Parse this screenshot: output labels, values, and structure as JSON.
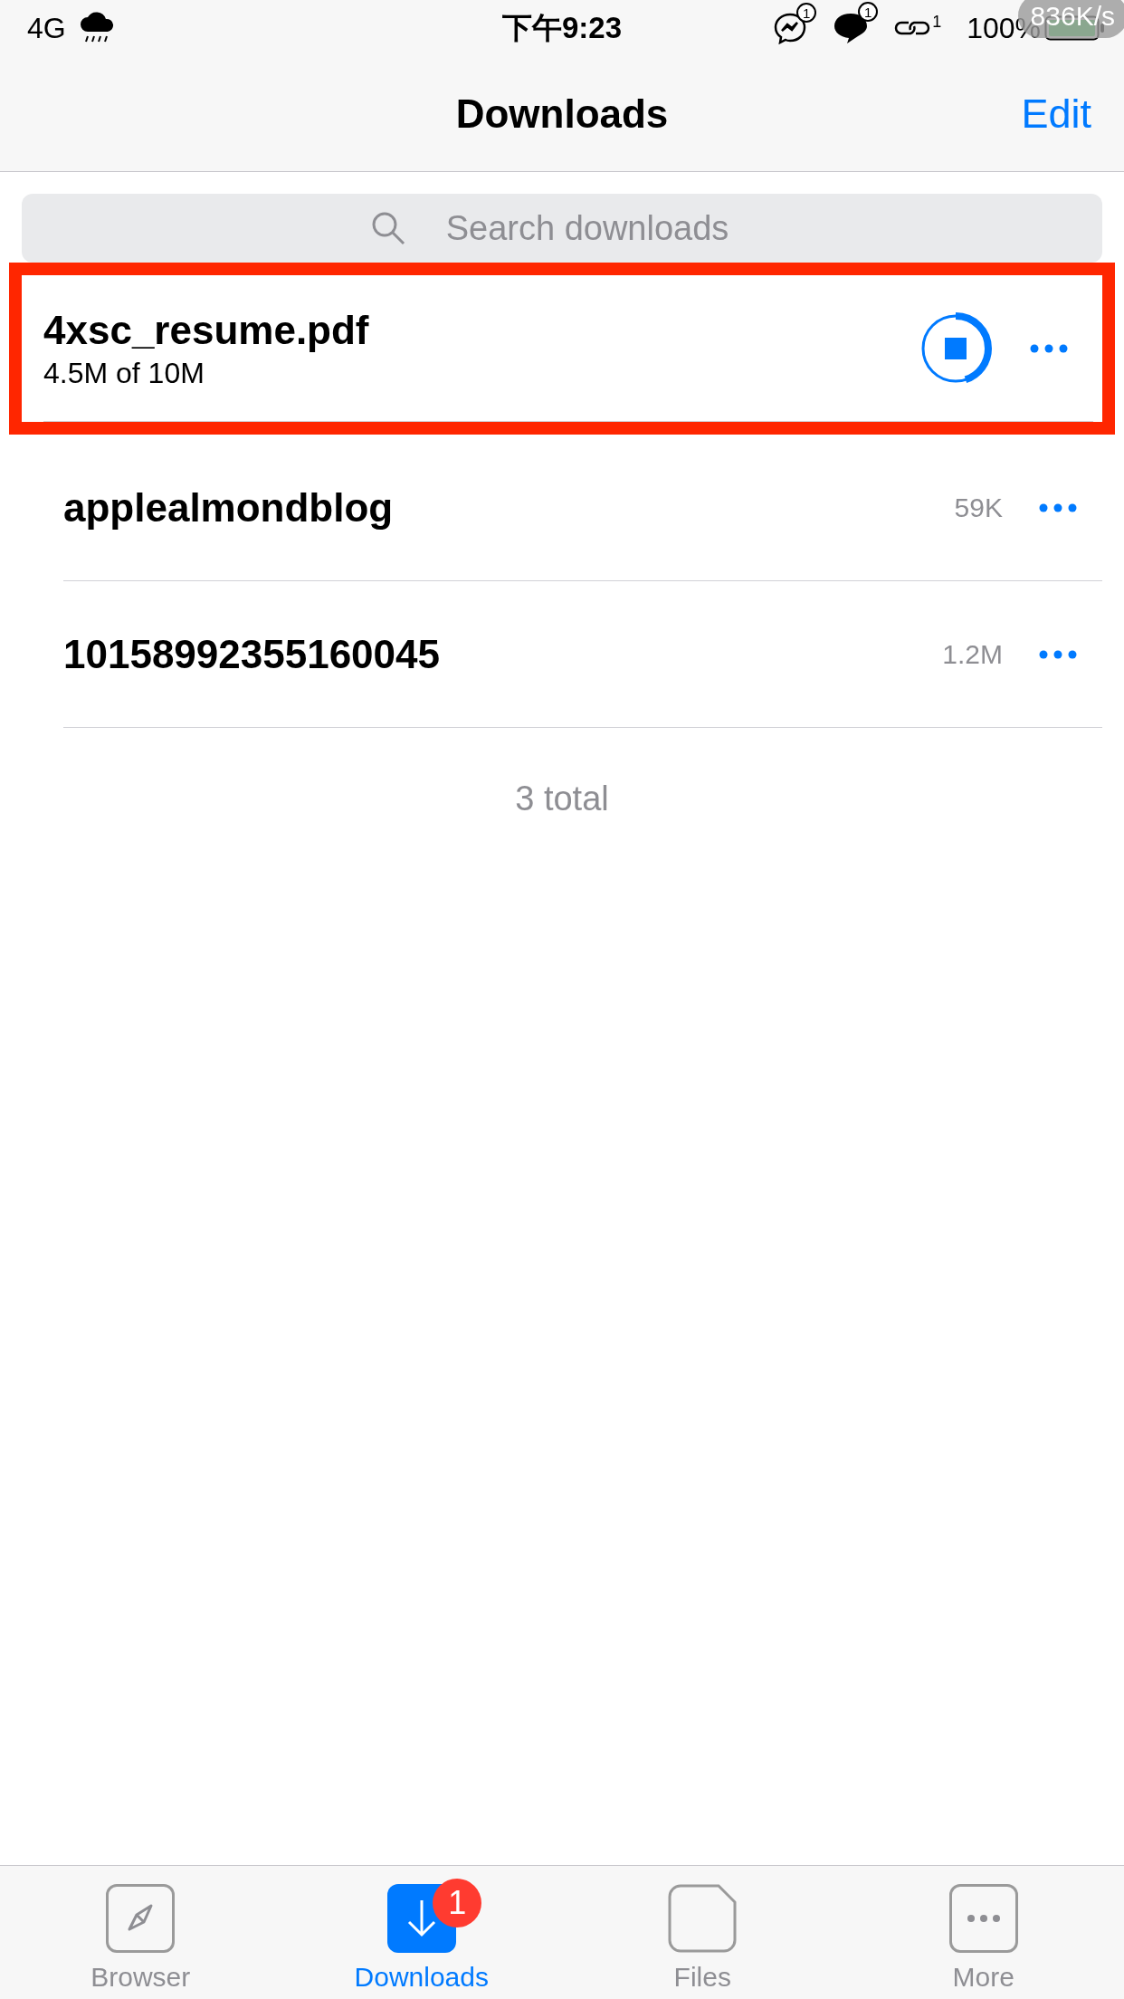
{
  "status_bar": {
    "carrier": "4G",
    "time": "下午9:23",
    "notification_counts": [
      "1",
      "1",
      "1"
    ],
    "battery": "100%",
    "speed": "836K/s"
  },
  "nav": {
    "title": "Downloads",
    "edit": "Edit"
  },
  "search": {
    "placeholder": "Search downloads"
  },
  "downloads": [
    {
      "kind": "progress",
      "name": "4xsc_resume.pdf",
      "detail": "4.5M of 10M",
      "highlighted": true
    },
    {
      "kind": "done",
      "name": "applealmondblog",
      "size": "59K",
      "highlighted": false
    },
    {
      "kind": "done",
      "name": "10158992355160045",
      "size": "1.2M",
      "highlighted": false
    }
  ],
  "total": "3 total",
  "tabs": [
    {
      "kind": "browser",
      "label": "Browser",
      "selected": false
    },
    {
      "kind": "downloads",
      "label": "Downloads",
      "selected": true,
      "badge": "1"
    },
    {
      "kind": "files",
      "label": "Files",
      "selected": false
    },
    {
      "kind": "more",
      "label": "More",
      "selected": false
    }
  ]
}
